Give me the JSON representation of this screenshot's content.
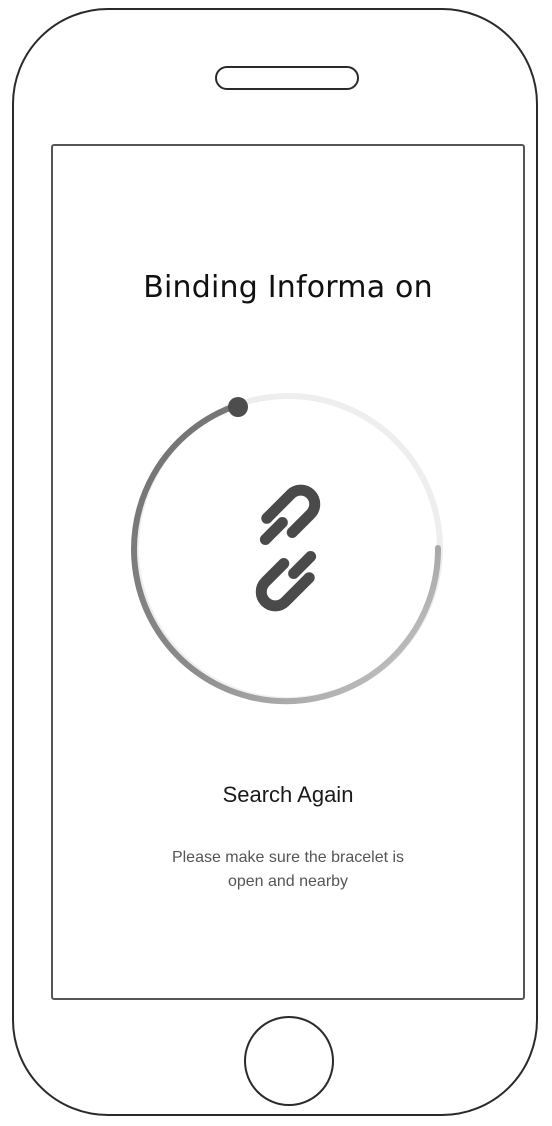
{
  "screen": {
    "title": "Binding Informa on",
    "search_again_label": "Search Again",
    "hint_line1": "Please make sure the bracelet is",
    "hint_line2": "open and nearby"
  },
  "icons": {
    "center": "link-icon",
    "home": "home-button"
  },
  "colors": {
    "progress_track": "#eeeeee",
    "progress_arc": "#9a9a9a",
    "progress_dot": "#4d4d4d",
    "link_icon": "#4a4a4a"
  }
}
